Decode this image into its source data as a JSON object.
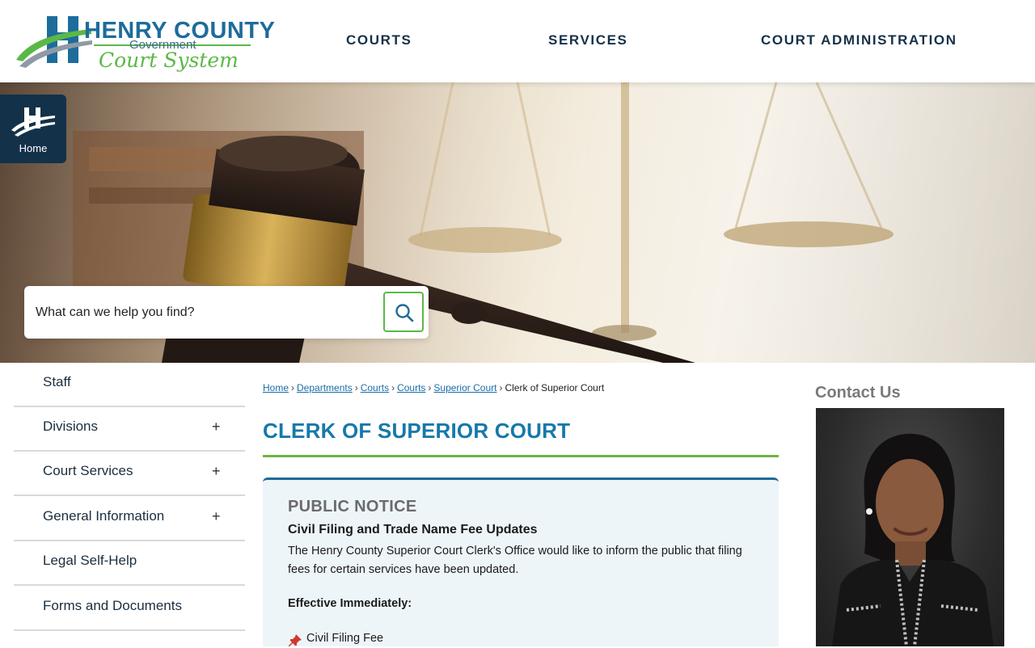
{
  "header": {
    "logo": {
      "title": "HENRY COUNTY",
      "subtitle": "Government",
      "script": "Court System"
    },
    "nav": [
      {
        "label": "COURTS"
      },
      {
        "label": "SERVICES"
      },
      {
        "label": "COURT ADMINISTRATION"
      }
    ]
  },
  "home_tab": {
    "label": "Home"
  },
  "search": {
    "placeholder": "What can we help you find?",
    "button_icon": "search-icon"
  },
  "sidebar": {
    "items": [
      {
        "label": "Staff",
        "expandable": false
      },
      {
        "label": "Divisions",
        "expandable": true,
        "expand_symbol": "+"
      },
      {
        "label": "Court Services",
        "expandable": true,
        "expand_symbol": "+"
      },
      {
        "label": "General Information",
        "expandable": true,
        "expand_symbol": "+"
      },
      {
        "label": "Legal Self-Help",
        "expandable": false
      },
      {
        "label": "Forms and Documents",
        "expandable": false
      }
    ]
  },
  "breadcrumb": {
    "links": [
      "Home",
      "Departments",
      "Courts",
      "Courts",
      "Superior Court"
    ],
    "separator": "›",
    "current": "Clerk of Superior Court"
  },
  "page": {
    "title": "CLERK OF SUPERIOR COURT"
  },
  "notice": {
    "heading": "PUBLIC NOTICE",
    "subheading": "Civil Filing and Trade Name Fee Updates",
    "body": "The Henry County Superior Court Clerk's Office would like to inform the public that filing fees for certain services have been updated.",
    "effective": "Effective Immediately:",
    "items": [
      {
        "icon": "pushpin-icon",
        "label": "Civil Filing Fee"
      }
    ]
  },
  "contact": {
    "title": "Contact Us"
  },
  "colors": {
    "navy": "#14314a",
    "brand_blue": "#1779aa",
    "brand_green": "#5bb847",
    "notice_bg": "#eef5f9"
  }
}
